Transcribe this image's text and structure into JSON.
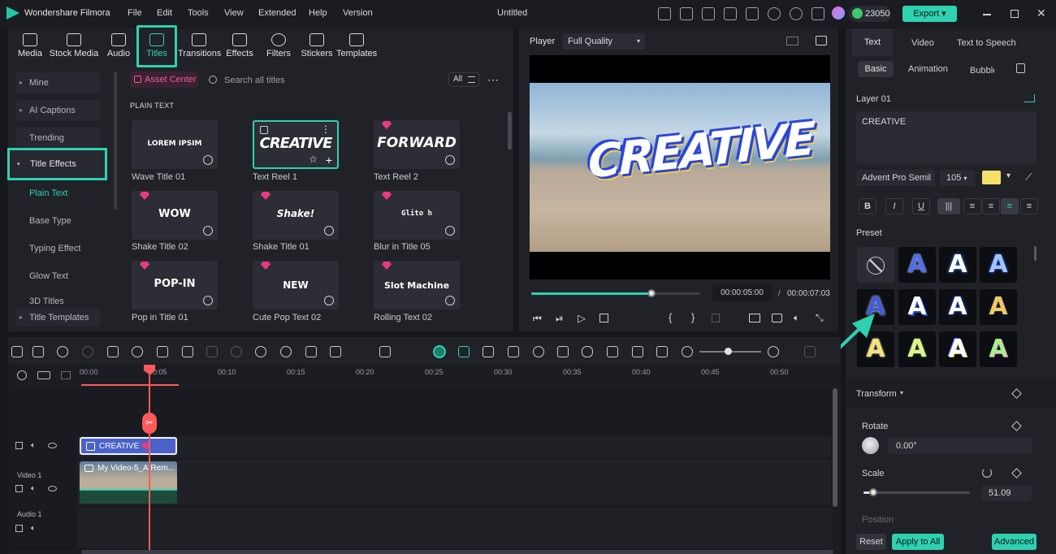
{
  "app": {
    "name": "Wondershare Filmora",
    "project": "Untitled",
    "credits": "23050",
    "export_label": "Export"
  },
  "menu": [
    "File",
    "Edit",
    "Tools",
    "View",
    "Extended",
    "Help",
    "Version"
  ],
  "media_tabs": [
    {
      "label": "Media",
      "icon": "media-icon"
    },
    {
      "label": "Stock Media",
      "icon": "stock-media-icon"
    },
    {
      "label": "Audio",
      "icon": "audio-icon"
    },
    {
      "label": "Titles",
      "icon": "titles-icon",
      "active": true
    },
    {
      "label": "Transitions",
      "icon": "transitions-icon"
    },
    {
      "label": "Effects",
      "icon": "effects-icon"
    },
    {
      "label": "Filters",
      "icon": "filters-icon"
    },
    {
      "label": "Stickers",
      "icon": "stickers-icon"
    },
    {
      "label": "Templates",
      "icon": "templates-icon"
    }
  ],
  "sidebar": [
    {
      "label": "Mine"
    },
    {
      "label": "AI Captions"
    },
    {
      "label": "Trending"
    },
    {
      "label": "Title Effects"
    },
    {
      "label": "Plain Text"
    },
    {
      "label": "Base Type"
    },
    {
      "label": "Typing Effect"
    },
    {
      "label": "Glow Text"
    },
    {
      "label": "3D Titles"
    },
    {
      "label": "Title Templates"
    }
  ],
  "library": {
    "asset_center": "Asset Center",
    "search_placeholder": "Search all titles",
    "filter": "All",
    "section": "PLAIN TEXT",
    "cards": [
      {
        "preview": "LOREM IPSIM",
        "caption": "Wave Title 01"
      },
      {
        "preview": "CREATIVE",
        "caption": "Text Reel 1"
      },
      {
        "preview": "FORWARD",
        "caption": "Text Reel 2"
      },
      {
        "preview": "WOW",
        "caption": "Shake Title 02"
      },
      {
        "preview": "Shake!",
        "caption": "Shake Title 01"
      },
      {
        "preview": "Glito h",
        "caption": "Blur in Title 05"
      },
      {
        "preview": "POP-IN",
        "caption": "Pop in Title 01"
      },
      {
        "preview": "NEW",
        "caption": "Cute Pop Text 02"
      },
      {
        "preview": "Slot Machine",
        "caption": "Rolling Text 02"
      }
    ]
  },
  "player": {
    "label": "Player",
    "quality": "Full Quality",
    "overlay_text": "CREATIVE",
    "current_time": "00:00:05:00",
    "total_time": "00:00:07:03",
    "separator": "/",
    "progress": 0.71
  },
  "right_panel": {
    "tabs": [
      "Text",
      "Video",
      "Text to Speech"
    ],
    "subtabs": [
      "Basic",
      "Animation",
      "Bubble"
    ],
    "layer": "Layer 01",
    "text_value": "CREATIVE",
    "font": "Advent Pro Semil",
    "font_size": "105",
    "font_color": "#f6e06a",
    "format_buttons": [
      "B",
      "I",
      "U"
    ],
    "preset_label": "Preset",
    "transform_label": "Transform",
    "rotate_label": "Rotate",
    "rotate_value": "0.00°",
    "scale_label": "Scale",
    "scale_value": "51.09",
    "scale_fraction": 0.09,
    "position_label": "Position",
    "reset": "Reset",
    "apply_all": "Apply to All",
    "advanced": "Advanced"
  },
  "timeline": {
    "ticks": [
      "00:00",
      "00:05",
      "00:10",
      "00:15",
      "00:20",
      "00:25",
      "00:30",
      "00:35",
      "00:40",
      "00:45",
      "00:50"
    ],
    "title_clip": "CREATIVE",
    "video_clip": "My Video-5_AIRem...",
    "tracks": [
      "Video 1",
      "Audio 1"
    ]
  },
  "colors": {
    "accent": "#2ed1b0",
    "bg": "#16171c",
    "panel": "#212228",
    "clip_title": "#4a62c9",
    "playhead": "#ff5a5a"
  }
}
